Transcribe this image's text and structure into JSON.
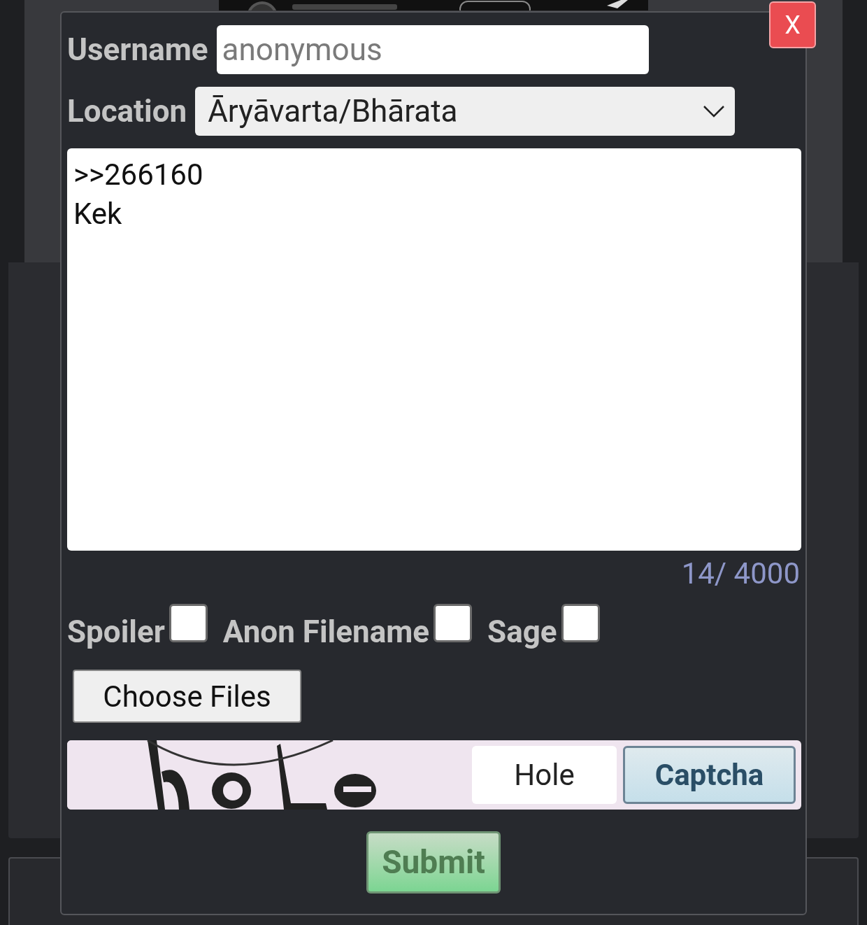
{
  "dialog": {
    "close": "X",
    "username": {
      "label": "Username",
      "placeholder": "anonymous"
    },
    "location": {
      "label": "Location",
      "value": "Āryāvarta/Bhārata"
    },
    "message": {
      "value": ">>266160\nKek",
      "counter": "14/ 4000"
    },
    "options": [
      {
        "label": "Spoiler",
        "checked": false
      },
      {
        "label": "Anon Filename",
        "checked": false
      },
      {
        "label": "Sage",
        "checked": false
      }
    ],
    "file_button": "Choose Files",
    "captcha": {
      "value": "Hole",
      "button": "Captcha"
    },
    "submit": "Submit"
  }
}
